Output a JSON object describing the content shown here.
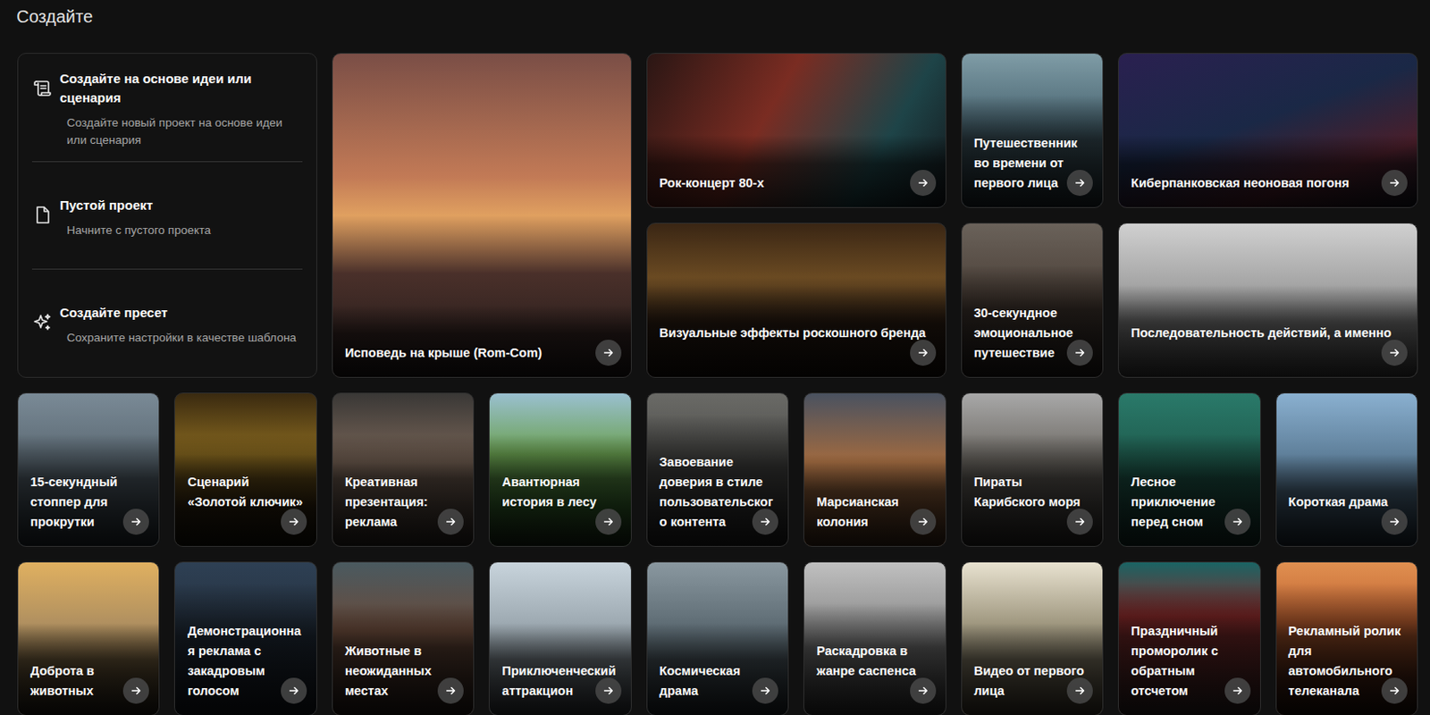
{
  "heading": "Создайте",
  "actions": [
    {
      "title": "Создайте на основе идеи или сценария",
      "description": "Создайте новый проект на основе идеи или сценария",
      "kind": "script"
    },
    {
      "title": "Пустой проект",
      "description": "Начните с пустого проекта",
      "kind": "blank"
    },
    {
      "title": "Создайте пресет",
      "description": "Сохраните настройки в качестве шаблона",
      "kind": "preset"
    }
  ],
  "templates": [
    {
      "title": "Исповедь на крыше (Rom-Com)",
      "kind": "tall"
    },
    {
      "title": "Рок-концерт 80-х",
      "kind": "wide"
    },
    {
      "title": "Путешественник во времени от первого лица",
      "kind": "narrow"
    },
    {
      "title": "Киберпанковская неоновая погоня",
      "kind": "wide"
    },
    {
      "title": "Визуальные эффекты роскошного бренда",
      "kind": "wide"
    },
    {
      "title": "30-секундное эмоциональное путешествие",
      "kind": "narrow"
    },
    {
      "title": "Последовательность действий, а именно",
      "kind": "wide"
    },
    {
      "title": "15-секундный стоппер для прокрутки",
      "kind": "tile"
    },
    {
      "title": "Сценарий «Золотой ключик»",
      "kind": "tile"
    },
    {
      "title": "Креативная презентация: реклама",
      "kind": "tile"
    },
    {
      "title": "Авантюрная история в лесу",
      "kind": "tile"
    },
    {
      "title": "Завоевание доверия в стиле пользовательского контента",
      "kind": "tile"
    },
    {
      "title": "Марсианская колония",
      "kind": "tile"
    },
    {
      "title": "Пираты Карибского моря",
      "kind": "tile"
    },
    {
      "title": "Лесное приключение перед сном",
      "kind": "tile"
    },
    {
      "title": "Короткая драма",
      "kind": "tile"
    },
    {
      "title": "Доброта в животных",
      "kind": "tile"
    },
    {
      "title": "Демонстрационная реклама с закадровым голосом",
      "kind": "tile"
    },
    {
      "title": "Животные в неожиданных местах",
      "kind": "tile"
    },
    {
      "title": "Приключенческий аттракцион",
      "kind": "tile"
    },
    {
      "title": "Космическая драма",
      "kind": "tile"
    },
    {
      "title": "Раскадровка в жанре саспенса",
      "kind": "tile"
    },
    {
      "title": "Видео от первого лица",
      "kind": "tile"
    },
    {
      "title": "Праздничный проморолик с обратным отсчетом",
      "kind": "tile"
    },
    {
      "title": "Рекламный ролик для автомобильного телеканала",
      "kind": "tile"
    }
  ]
}
